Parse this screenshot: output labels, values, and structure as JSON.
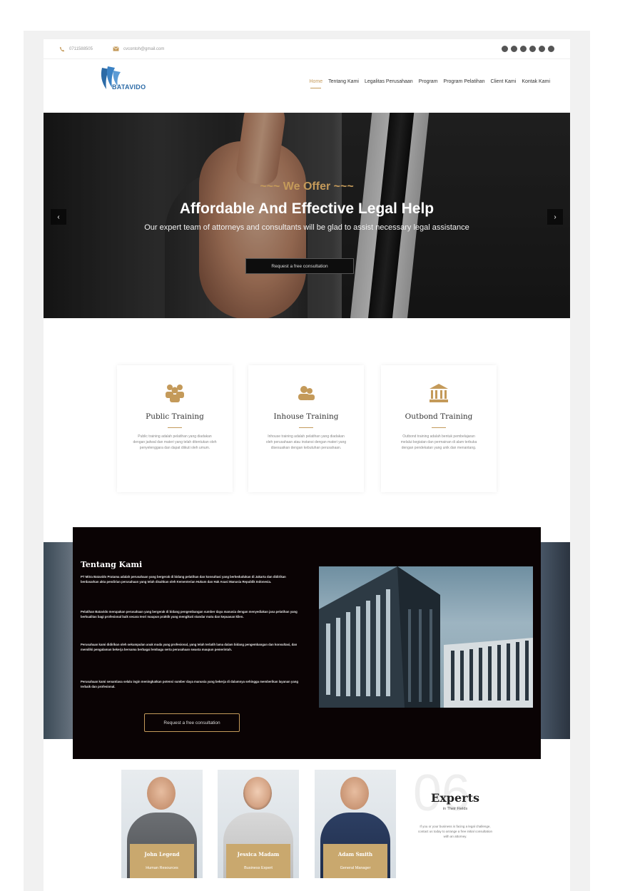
{
  "topbar": {
    "phone": "0711588505",
    "email": "cvcontoh@gmail.com",
    "social_icons": [
      "facebook-icon",
      "twitter-icon",
      "instagram-icon",
      "linkedin-icon",
      "youtube-icon",
      "google-icon"
    ]
  },
  "header": {
    "logo_text": "BATAVIDO",
    "nav": [
      {
        "label": "Home",
        "active": true
      },
      {
        "label": "Tentang Kami",
        "active": false
      },
      {
        "label": "Legalitas Perusahaan",
        "active": false
      },
      {
        "label": "Program",
        "active": false
      },
      {
        "label": "Program Pelatihan",
        "active": false
      },
      {
        "label": "Client Kami",
        "active": false
      },
      {
        "label": "Kontak Kami",
        "active": false
      }
    ]
  },
  "hero": {
    "eyebrow": "~~~ We Offer ~~~",
    "title": "Affordable And Effective Legal Help",
    "subtitle": "Our expert team of attorneys and consultants will be glad to assist necessary legal assistance",
    "cta": "Request a free consultation",
    "prev": "‹",
    "next": "›"
  },
  "services": [
    {
      "icon": "group-icon",
      "title": "Public Training",
      "desc": "Public training adalah pelatihan yang diadakan dengan jadwal dan materi yang telah ditentukan oleh penyelenggara dan dapat diikuti oleh umum."
    },
    {
      "icon": "users-icon",
      "title": "Inhouse Training",
      "desc": "Inhouse training adalah pelatihan yang diadakan oleh perusahaan atau instansi dengan materi yang disesuaikan dengan kebutuhan perusahaan."
    },
    {
      "icon": "bank-icon",
      "title": "Outbond Training",
      "desc": "Outbond training adalah bentuk pembelajaran melalui kegiatan dan permainan di alam terbuka dengan pendekatan yang unik dan menantang."
    }
  ],
  "about": {
    "title": "Tentang Kami",
    "paragraphs": [
      "PT Mitra Batavido Pratama adalah perusahaan yang bergerak di bidang pelatihan dan konsultasi yang berkedudukan di Jakarta dan didirikan berdasarkan akta pendirian perusahaan yang telah disahkan oleh Kementerian Hukum dan Hak Asasi Manusia Republik Indonesia.",
      "Pelatihan Batavido merupakan perusahaan yang bergerak di bidang pengembangan sumber daya manusia dengan menyediakan jasa pelatihan yang berkualitas bagi profesional baik secara teori maupun praktik yang mengikuti standar mutu dan kepuasan klien.",
      "Perusahaan kami didirikan oleh sekumpulan anak muda yang profesional, yang telah terlatih lama dalam bidang pengembangan dan konsultasi, dan memiliki pengalaman bekerja bersama berbagai lembaga serta perusahaan swasta maupun pemerintah.",
      "Perusahaan kami senantiasa selalu ingin meningkatkan potensi sumber daya manusia yang bekerja di dalamnya sehingga memberikan layanan yang terbaik dan profesional."
    ],
    "cta": "Request a free consultation"
  },
  "experts": [
    {
      "name": "John Legend",
      "role": "Human Resources"
    },
    {
      "name": "Jessica Madam",
      "role": "Business Expert"
    },
    {
      "name": "Adam Smith",
      "role": "General Manager"
    }
  ],
  "experts_info": {
    "number": "06",
    "title": "Experts",
    "subtitle": "in Their Fields",
    "desc": "If you or your business is facing a legal challenge, contact us today to arrange a free initial consultation with an attorney."
  },
  "colors": {
    "accent": "#c49a5a",
    "dark": "#0a0304",
    "plate": "#c9a86e"
  }
}
